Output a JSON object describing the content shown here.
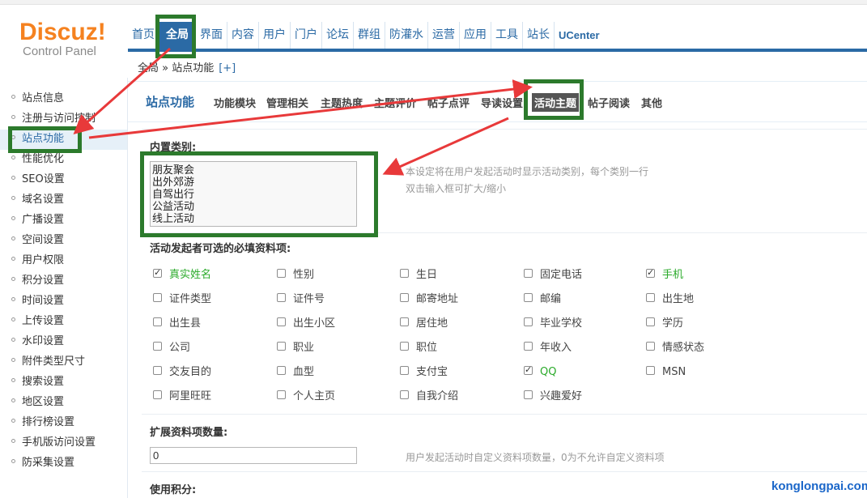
{
  "logo": {
    "brand": "Discuz!",
    "subtitle": "Control Panel"
  },
  "nav": {
    "items": [
      "首页",
      "全局",
      "界面",
      "内容",
      "用户",
      "门户",
      "论坛",
      "群组",
      "防灌水",
      "运营",
      "应用",
      "工具",
      "站长",
      "UCenter"
    ],
    "active": "全局"
  },
  "breadcrumb": {
    "path": "全局 » 站点功能",
    "add": "[+]"
  },
  "sidebar": {
    "items": [
      "站点信息",
      "注册与访问控制",
      "站点功能",
      "性能优化",
      "SEO设置",
      "域名设置",
      "广播设置",
      "空间设置",
      "用户权限",
      "积分设置",
      "时间设置",
      "上传设置",
      "水印设置",
      "附件类型尺寸",
      "搜索设置",
      "地区设置",
      "排行榜设置",
      "手机版访问设置",
      "防采集设置"
    ],
    "active": "站点功能"
  },
  "tabs": {
    "title": "站点功能",
    "items": [
      "功能模块",
      "管理相关",
      "主题热度",
      "主题评价",
      "帖子点评",
      "导读设置",
      "活动主题",
      "帖子阅读",
      "其他"
    ],
    "active": "活动主题"
  },
  "builtin_types": {
    "label": "内置类别:",
    "values": [
      "朋友聚会",
      "出外郊游",
      "自驾出行",
      "公益活动",
      "线上活动"
    ],
    "hint_line1": "本设定将在用户发起活动时显示活动类别，每个类别一行",
    "hint_line2": "双击输入框可扩大/缩小"
  },
  "required_fields": {
    "label": "活动发起者可选的必填资料项:",
    "options": [
      {
        "label": "真实姓名",
        "checked": true
      },
      {
        "label": "性别",
        "checked": false
      },
      {
        "label": "生日",
        "checked": false
      },
      {
        "label": "固定电话",
        "checked": false
      },
      {
        "label": "手机",
        "checked": true
      },
      {
        "label": "证件类型",
        "checked": false
      },
      {
        "label": "证件号",
        "checked": false
      },
      {
        "label": "邮寄地址",
        "checked": false
      },
      {
        "label": "邮编",
        "checked": false
      },
      {
        "label": "出生地",
        "checked": false
      },
      {
        "label": "出生县",
        "checked": false
      },
      {
        "label": "出生小区",
        "checked": false
      },
      {
        "label": "居住地",
        "checked": false
      },
      {
        "label": "毕业学校",
        "checked": false
      },
      {
        "label": "学历",
        "checked": false
      },
      {
        "label": "公司",
        "checked": false
      },
      {
        "label": "职业",
        "checked": false
      },
      {
        "label": "职位",
        "checked": false
      },
      {
        "label": "年收入",
        "checked": false
      },
      {
        "label": "情感状态",
        "checked": false
      },
      {
        "label": "交友目的",
        "checked": false
      },
      {
        "label": "血型",
        "checked": false
      },
      {
        "label": "支付宝",
        "checked": false
      },
      {
        "label": "QQ",
        "checked": true
      },
      {
        "label": "MSN",
        "checked": false
      },
      {
        "label": "阿里旺旺",
        "checked": false
      },
      {
        "label": "个人主页",
        "checked": false
      },
      {
        "label": "自我介绍",
        "checked": false
      },
      {
        "label": "兴趣爱好",
        "checked": false
      }
    ]
  },
  "extended_count": {
    "label": "扩展资料项数量:",
    "value": "0",
    "hint": "用户发起活动时自定义资料项数量，0为不允许自定义资料项"
  },
  "use_credits": {
    "label": "使用积分:"
  },
  "watermark": "konglongpai.com",
  "colors": {
    "accent": "#2b6aa5",
    "logo": "#f58220",
    "annotation": "#2c7a2c",
    "arrow": "#e8393a",
    "checked_text": "#2aaa2a"
  }
}
